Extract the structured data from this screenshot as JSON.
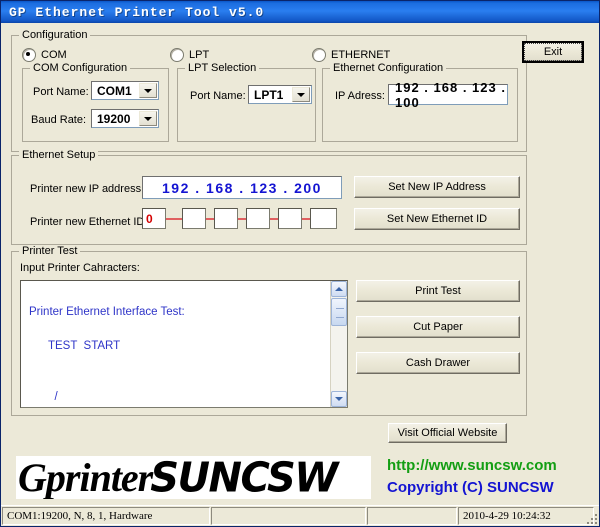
{
  "window": {
    "title": "GP Ethernet Printer Tool v5.0",
    "exit_button": "Exit"
  },
  "configuration": {
    "legend": "Configuration",
    "modes": [
      {
        "label": "COM",
        "selected": true
      },
      {
        "label": "LPT",
        "selected": false
      },
      {
        "label": "ETHERNET",
        "selected": false
      }
    ],
    "com": {
      "legend": "COM Configuration",
      "port_name_label": "Port Name:",
      "port_name_value": "COM1",
      "baud_rate_label": "Baud Rate:",
      "baud_rate_value": "19200"
    },
    "lpt": {
      "legend": "LPT Selection",
      "port_name_label": "Port Name:",
      "port_name_value": "LPT1"
    },
    "ethernet": {
      "legend": "Ethernet Configuration",
      "ip_label": "IP Adress:",
      "ip_value": "192 . 168 . 123 . 100"
    }
  },
  "ethernet_setup": {
    "legend": "Ethernet Setup",
    "new_ip_label": "Printer new IP address:",
    "new_ip_value": "192 . 168 . 123 . 200",
    "new_id_label": "Printer new Ethernet ID:",
    "new_id_octets": [
      "0",
      "",
      "",
      "",
      "",
      ""
    ],
    "set_ip_button": "Set New IP Address",
    "set_id_button": "Set New Ethernet ID"
  },
  "printer_test": {
    "legend": "Printer Test",
    "input_label": "Input Printer Cahracters:",
    "textarea_value": "\nPrinter Ethernet Interface Test:\n\n      TEST  START\n\n\n        /\n       ///\n      /////",
    "print_test_button": "Print Test",
    "cut_paper_button": "Cut Paper",
    "cash_drawer_button": "Cash Drawer"
  },
  "branding": {
    "logo_serif": "Gprinter",
    "logo_bold": "SUNCSW",
    "visit_button": "Visit Official Website",
    "url": "http://www.suncsw.com",
    "copyright": "Copyright (C) SUNCSW"
  },
  "statusbar": {
    "panels": [
      "COM1:19200, N, 8, 1, Hardware",
      "",
      "",
      "2010-4-29  10:24:32"
    ]
  },
  "colors": {
    "titlebar": "#1b6de0",
    "face": "#ece9d8",
    "blue_text": "#1414d2",
    "green_text": "#139e13",
    "red_text": "#d40000",
    "editor_text": "#2f35c8"
  }
}
